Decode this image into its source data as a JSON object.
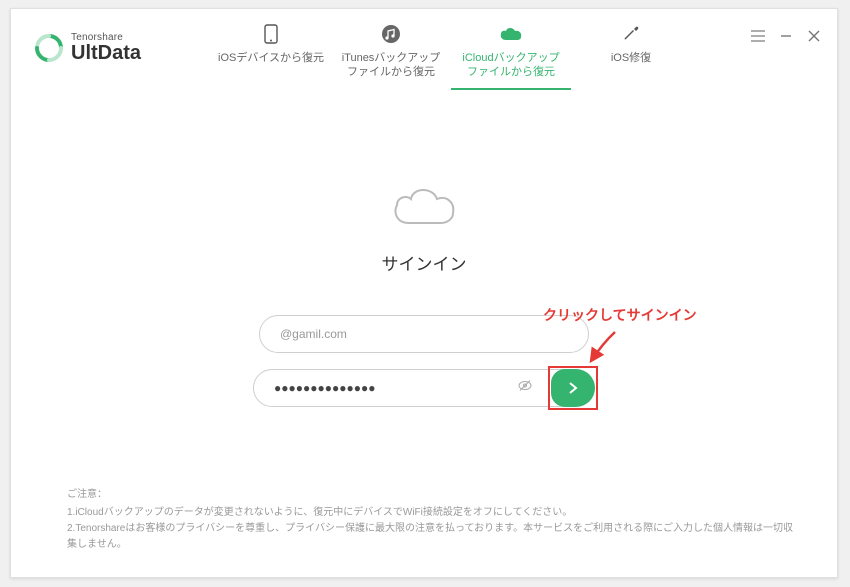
{
  "logo": {
    "vendor": "Tenorshare",
    "product": "UltData"
  },
  "tabs": [
    {
      "label": "iOSデバイスから復元"
    },
    {
      "label": "iTunesバックアップ\nファイルから復元"
    },
    {
      "label": "iCloudバックアップ\nファイルから復元"
    },
    {
      "label": "iOS修復"
    }
  ],
  "main": {
    "title": "サインイン",
    "email_value": "@gamil.com",
    "password_value": "●●●●●●●●●●●●●●"
  },
  "annotation": {
    "text": "クリックしてサインイン"
  },
  "footer": {
    "heading": "ご注意：",
    "line1": "1.iCloudバックアップのデータが変更されないように、復元中にデバイスでWiFi接続設定をオフにしてください。",
    "line2": "2.Tenorshareはお客様のプライバシーを尊重し、プライバシー保護に最大限の注意を払っております。本サービスをご利用される際にご入力した個人情報は一切収集しません。"
  },
  "colors": {
    "accent": "#35b46f",
    "annotation": "#e53935"
  }
}
